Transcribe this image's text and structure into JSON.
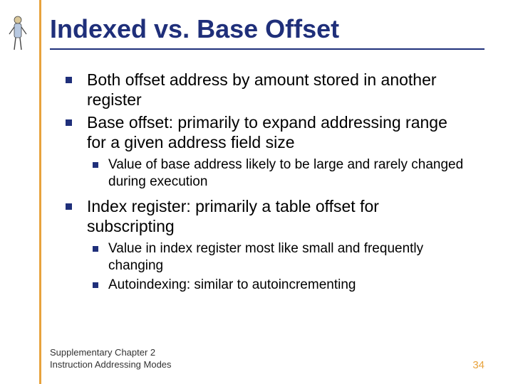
{
  "title": "Indexed vs. Base Offset",
  "bullets": {
    "b1": "Both offset address by amount stored in another register",
    "b2": "Base offset:  primarily to expand addressing range for a given address field size",
    "b2_1": "Value of base address likely to be large and rarely changed during execution",
    "b3": "Index register: primarily a table offset for subscripting",
    "b3_1": "Value in index register most like small and frequently changing",
    "b3_2": "Autoindexing:  similar to autoincrementing"
  },
  "footer": {
    "line1": "Supplementary Chapter 2",
    "line2": "Instruction Addressing Modes",
    "page": "34"
  }
}
